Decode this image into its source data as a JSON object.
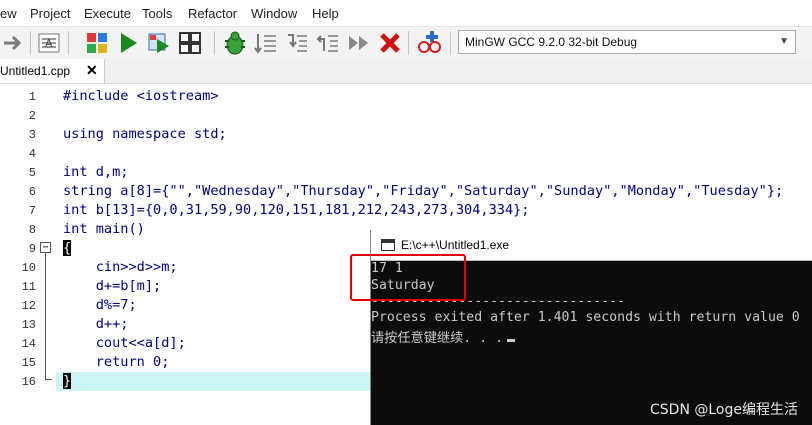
{
  "menu": [
    {
      "label": "ew"
    },
    {
      "label": "Project"
    },
    {
      "label": "Execute"
    },
    {
      "label": "Tools"
    },
    {
      "label": "Refactor"
    },
    {
      "label": "Window"
    },
    {
      "label": "Help"
    }
  ],
  "toolbar": {
    "compiler": "MinGW GCC 9.2.0 32-bit Debug",
    "icons": [
      "arrow-right-icon",
      "comment-icon",
      "compile-icon",
      "run-icon",
      "compile-run-icon",
      "rebuild-icon",
      "debug-icon",
      "step-icon",
      "step-into-icon",
      "step-out-icon",
      "continue-icon",
      "stop-icon",
      "profile-icon"
    ]
  },
  "tabs": [
    {
      "label": "Untitled1.cpp"
    }
  ],
  "code": [
    {
      "n": "1",
      "text": "#include <iostream>"
    },
    {
      "n": "2",
      "text": ""
    },
    {
      "n": "3",
      "text": "using namespace std;"
    },
    {
      "n": "4",
      "text": ""
    },
    {
      "n": "5",
      "text": "int d,m;"
    },
    {
      "n": "6",
      "text": "string a[8]={\"\",\"Wednesday\",\"Thursday\",\"Friday\",\"Saturday\",\"Sunday\",\"Monday\",\"Tuesday\"};"
    },
    {
      "n": "7",
      "text": "int b[13]={0,0,31,59,90,120,151,181,212,243,273,304,334};"
    },
    {
      "n": "8",
      "text": "int main()"
    },
    {
      "n": "9",
      "text": "{"
    },
    {
      "n": "10",
      "text": "    cin>>d>>m;"
    },
    {
      "n": "11",
      "text": "    d+=b[m];"
    },
    {
      "n": "12",
      "text": "    d%=7;"
    },
    {
      "n": "13",
      "text": "    d++;"
    },
    {
      "n": "14",
      "text": "    cout<<a[d];"
    },
    {
      "n": "15",
      "text": "    return 0;"
    },
    {
      "n": "16",
      "text": "}"
    }
  ],
  "console": {
    "title": "E:\\c++\\Untitled1.exe",
    "lines": [
      "17 1",
      "Saturday",
      "--------------------------------",
      "Process exited after 1.401 seconds with return value 0",
      "请按任意键继续. . ."
    ]
  },
  "watermark": "CSDN @Loge编程生活",
  "colors": {
    "highlight": "#ccf6f6",
    "console_bg": "#0c0c0c",
    "console_text": "#c8c8c8",
    "red_box": "#e00000"
  }
}
